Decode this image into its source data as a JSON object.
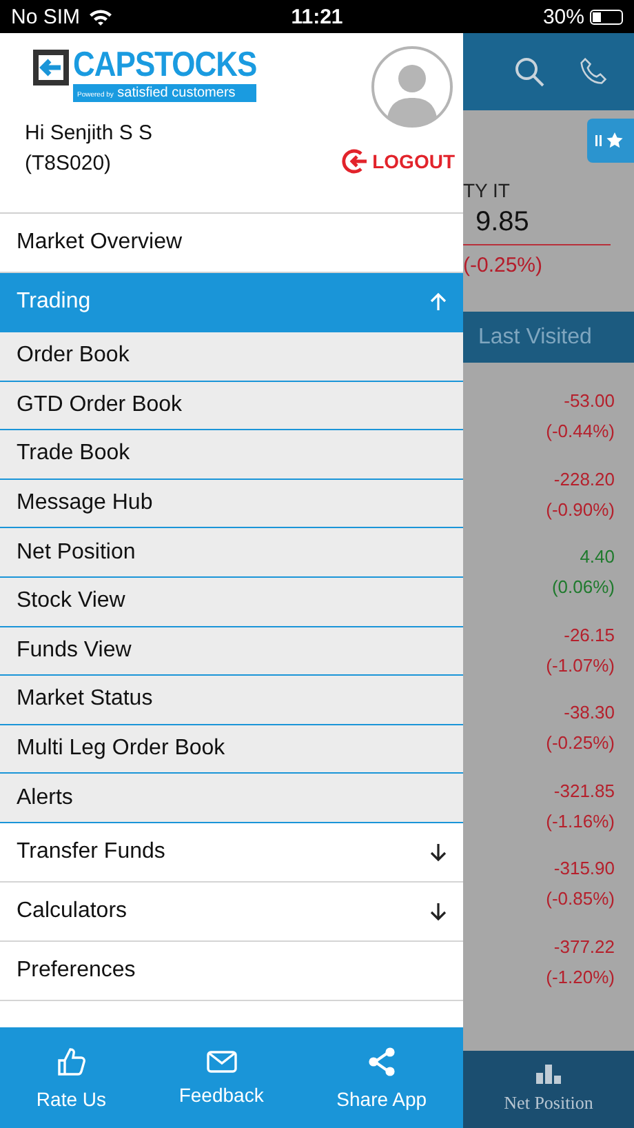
{
  "status_bar": {
    "carrier": "No SIM",
    "time": "11:21",
    "battery": "30%"
  },
  "background_screen": {
    "index_name": "TY IT",
    "index_value": "9.85",
    "index_change": "(-0.25%)",
    "tab": "Last Visited",
    "rows": [
      {
        "change": "-53.00",
        "percent": "(-0.44%)",
        "color": "#b5202c"
      },
      {
        "change": "-228.20",
        "percent": "(-0.90%)",
        "color": "#b5202c"
      },
      {
        "change": "4.40",
        "percent": "(0.06%)",
        "color": "#1f7a2d"
      },
      {
        "change": "-26.15",
        "percent": "(-1.07%)",
        "color": "#b5202c"
      },
      {
        "change": "-38.30",
        "percent": "(-0.25%)",
        "color": "#b5202c"
      },
      {
        "change": "-321.85",
        "percent": "(-1.16%)",
        "color": "#b5202c"
      },
      {
        "change": "-315.90",
        "percent": "(-0.85%)",
        "color": "#b5202c"
      },
      {
        "change": "-377.22",
        "percent": "(-1.20%)",
        "color": "#b5202c"
      }
    ],
    "nav_item": "Net Position"
  },
  "drawer": {
    "logo": {
      "name": "CAPSTOCKS",
      "tagline_small": "Powered by",
      "tagline": "satisfied customers"
    },
    "greeting": "Hi Senjith S S",
    "client_code": "(T8S020)",
    "logout": "LOGOUT",
    "menu": [
      {
        "label": "Market Overview",
        "kind": "item",
        "selected": false
      },
      {
        "label": "Trading",
        "kind": "group",
        "selected": true,
        "expanded": true,
        "children": [
          {
            "label": "Order Book"
          },
          {
            "label": "GTD Order Book"
          },
          {
            "label": "Trade Book"
          },
          {
            "label": "Message Hub"
          },
          {
            "label": "Net Position"
          },
          {
            "label": "Stock View"
          },
          {
            "label": "Funds View"
          },
          {
            "label": "Market Status"
          },
          {
            "label": "Multi Leg Order Book"
          },
          {
            "label": "Alerts"
          }
        ]
      },
      {
        "label": "Transfer Funds",
        "kind": "group",
        "selected": false,
        "expanded": false
      },
      {
        "label": "Calculators",
        "kind": "group",
        "selected": false,
        "expanded": false
      },
      {
        "label": "Preferences",
        "kind": "item",
        "selected": false
      }
    ],
    "footer": [
      {
        "label": "Rate Us",
        "kind": "rate"
      },
      {
        "label": "Feedback",
        "kind": "feedback"
      },
      {
        "label": "Share App",
        "kind": "share"
      }
    ]
  }
}
